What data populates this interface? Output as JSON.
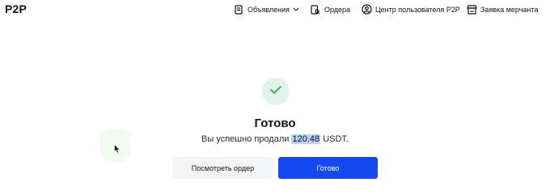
{
  "app": {
    "logo": "P2P"
  },
  "nav": {
    "ads": {
      "label": "Объявления",
      "icon": "document-list-icon"
    },
    "orders": {
      "label": "Ордера",
      "icon": "orders-search-icon"
    },
    "user_center": {
      "label": "Центр пользователя P2P",
      "icon": "user-icon"
    },
    "merchant": {
      "label": "Заявка мерчанта",
      "icon": "store-icon"
    }
  },
  "result": {
    "icon": "checkmark-icon",
    "title": "Готово",
    "message_prefix": "Вы успешно продали",
    "amount": "120.48",
    "currency": "USDT."
  },
  "buttons": {
    "view_order": "Посмотреть ордер",
    "done": "Готово"
  },
  "colors": {
    "primary": "#1648f0",
    "success": "#3fae6b",
    "success_bg": "#e3f2e9",
    "selection": "#b8d3f5"
  }
}
